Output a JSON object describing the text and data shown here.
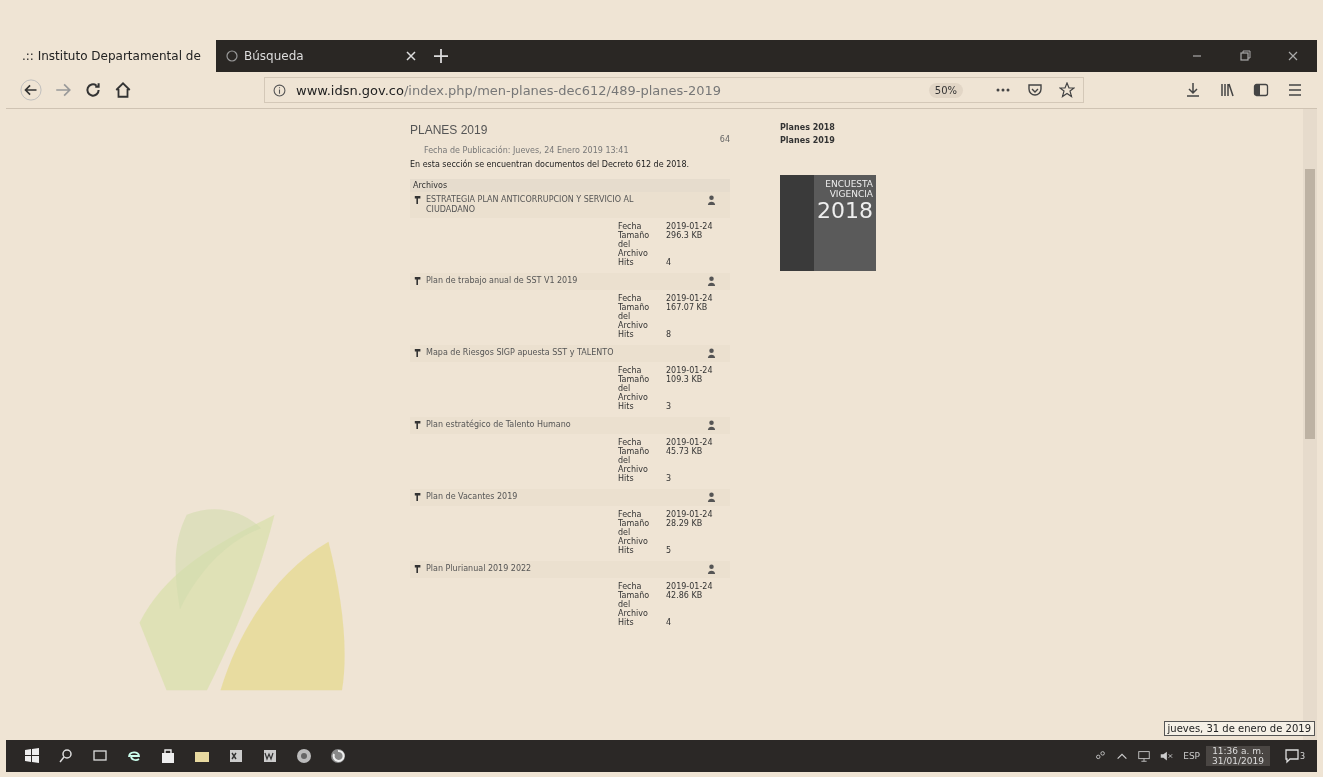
{
  "browser": {
    "tabs": [
      {
        "title": ".:: Instituto Departamental de",
        "selected": true
      },
      {
        "title": "Búsqueda",
        "selected": false
      }
    ],
    "address": {
      "domain": "www.idsn.gov.co",
      "path": "/index.php/men-planes-dec612/489-planes-2019"
    },
    "zoom": "50%"
  },
  "article": {
    "title": "PLANES 2019",
    "hits": "64",
    "published": "Fecha de Publicación: Jueves, 24 Enero 2019 13:41",
    "intro": "En esta sección se encuentran documentos del Decreto 612 de 2018.",
    "files_heading": "Archivos",
    "files": [
      {
        "name": "ESTRATEGIA PLAN ANTICORRUPCION Y SERVICIO AL CIUDADANO",
        "date_label": "Fecha",
        "date": "2019-01-24",
        "size_label": "Tamaño del Archivo",
        "size": "296.3 KB",
        "hits_label": "Hits",
        "hits": "4"
      },
      {
        "name": "Plan de trabajo anual de SST V1 2019",
        "date_label": "Fecha",
        "date": "2019-01-24",
        "size_label": "Tamaño del Archivo",
        "size": "167.07 KB",
        "hits_label": "Hits",
        "hits": "8"
      },
      {
        "name": "Mapa de Riesgos SIGP apuesta SST y TALENTO",
        "date_label": "Fecha",
        "date": "2019-01-24",
        "size_label": "Tamaño del Archivo",
        "size": "109.3 KB",
        "hits_label": "Hits",
        "hits": "3"
      },
      {
        "name": "Plan estratégico de Talento Humano",
        "date_label": "Fecha",
        "date": "2019-01-24",
        "size_label": "Tamaño del Archivo",
        "size": "45.73 KB",
        "hits_label": "Hits",
        "hits": "3"
      },
      {
        "name": "Plan de Vacantes 2019",
        "date_label": "Fecha",
        "date": "2019-01-24",
        "size_label": "Tamaño del Archivo",
        "size": "28.29 KB",
        "hits_label": "Hits",
        "hits": "5"
      },
      {
        "name": "Plan Plurianual 2019 2022",
        "date_label": "Fecha",
        "date": "2019-01-24",
        "size_label": "Tamaño del Archivo",
        "size": "42.86 KB",
        "hits_label": "Hits",
        "hits": "4"
      }
    ]
  },
  "sidebar": {
    "links": [
      "Planes 2018",
      "Planes 2019"
    ],
    "banner": {
      "line_1": "ENCUESTA",
      "line_2": "VIGENCIA",
      "line_3": "2018"
    }
  },
  "taskbar": {
    "language": "ESP",
    "time": "11:36 a. m.",
    "date": "31/01/2019",
    "notifications": "3",
    "tooltip": "jueves, 31 de enero de 2019"
  }
}
